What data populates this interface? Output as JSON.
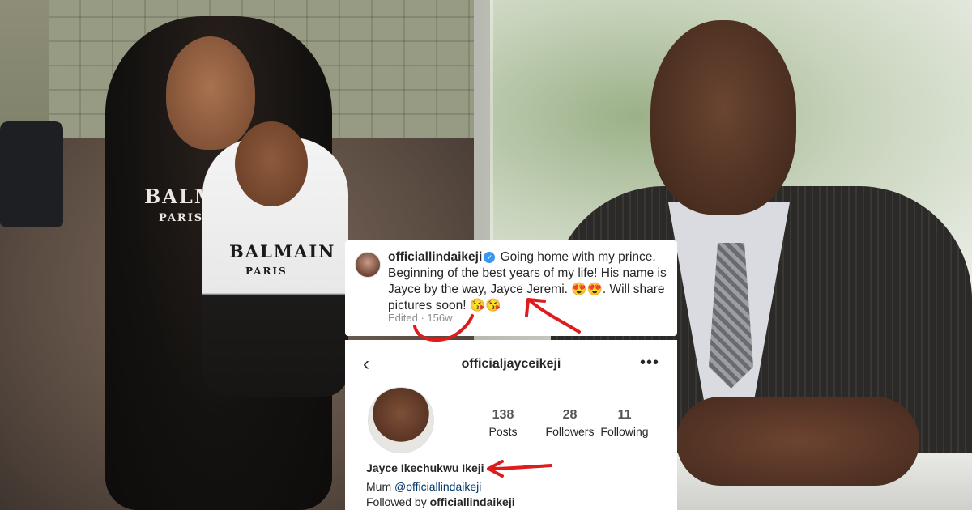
{
  "caption": {
    "username": "officiallindaikeji",
    "text": "Going home with my prince. Beginning of the best years of my life! His name is Jayce by the way, Jayce Jeremi. 😍😍. Will share pictures soon! 😘😘",
    "edited_label": "Edited · 156w"
  },
  "profile": {
    "handle": "officialjayceikeji",
    "stats": [
      {
        "value": "138",
        "label": "Posts"
      },
      {
        "value": "28",
        "label": "Followers"
      },
      {
        "value": "11",
        "label": "Following"
      }
    ],
    "name": "Jayce Ikechukwu Ikeji",
    "bio_prefix": "Mum",
    "bio_mention": "@officiallindaikeji",
    "followed_by_prefix": "Followed by",
    "followed_by_user": "officiallindaikeji"
  },
  "shirts": {
    "woman_shirt_brand": "BALMAIN",
    "woman_shirt_city": "PARIS",
    "boy_shirt_brand": "BALMAIN",
    "boy_shirt_city": "PARIS"
  },
  "colors": {
    "verified_blue": "#3897f0",
    "annotation_red": "#e01b1b",
    "link_blue": "#00376b"
  },
  "icons": [
    "verified-badge-icon",
    "back-arrow-icon",
    "more-options-icon"
  ]
}
